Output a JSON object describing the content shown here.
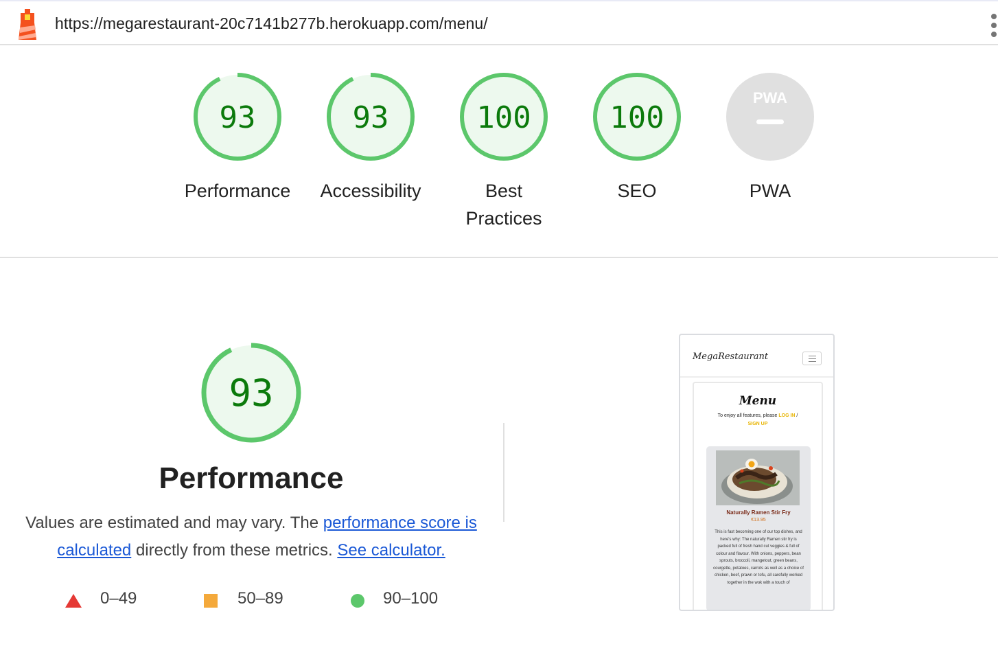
{
  "topbar": {
    "url": "https://megarestaurant-20c7141b277b.herokuapp.com/menu/",
    "logo_icon": "lighthouse-icon",
    "menu_icon": "kebab-menu-icon"
  },
  "gauges": [
    {
      "id": "performance",
      "score": "93",
      "label": "Performance",
      "fraction": 0.93
    },
    {
      "id": "accessibility",
      "score": "93",
      "label": "Accessibility",
      "fraction": 0.93
    },
    {
      "id": "best-practices",
      "score": "100",
      "label": "Best Practices",
      "fraction": 1.0
    },
    {
      "id": "seo",
      "score": "100",
      "label": "SEO",
      "fraction": 1.0
    },
    {
      "id": "pwa",
      "score": "",
      "label": "PWA",
      "badge": "PWA"
    }
  ],
  "performance": {
    "score": "93",
    "fraction": 0.93,
    "title": "Performance",
    "desc_prefix": "Values are estimated and may vary. The",
    "link_score": "performance score is calculated",
    "desc_middle": "directly from these metrics.",
    "link_calculator": "See calculator.",
    "legend": [
      {
        "shape": "triangle",
        "range": "0–49",
        "color": "#e53935"
      },
      {
        "shape": "square",
        "range": "50–89",
        "color": "#f4a93b"
      },
      {
        "shape": "circle",
        "range": "90–100",
        "color": "#5cc76b"
      }
    ]
  },
  "thumbnail": {
    "brand": "MegaRestaurant",
    "menu_title": "Menu",
    "info_prefix": "To enjoy all features, please",
    "log_in": "LOG IN",
    "separator": "/",
    "sign_up": "SIGN UP",
    "dish_name": "Naturally Ramen Stir Fry",
    "dish_price": "€13.95",
    "dish_desc": "This is fast becoming one of our top dishes, and here's why: The naturally Ramen stir fry is packed full of fresh hand cut veggies & full of colour and flavour. With onions, peppers, bean sprouts, broccoli, mangetout, green beans, courgette, potatoes, carrots as well as a choice of chicken, beef, prawn or tofu, all carefully worked together in the wok with a touch of"
  },
  "colors": {
    "pass_ring": "#5cc76b",
    "pass_fill": "#edf9ee",
    "pass_text": "#0b7a0b",
    "pwa_gray": "#e0e0e0",
    "link": "#1a58d6"
  }
}
